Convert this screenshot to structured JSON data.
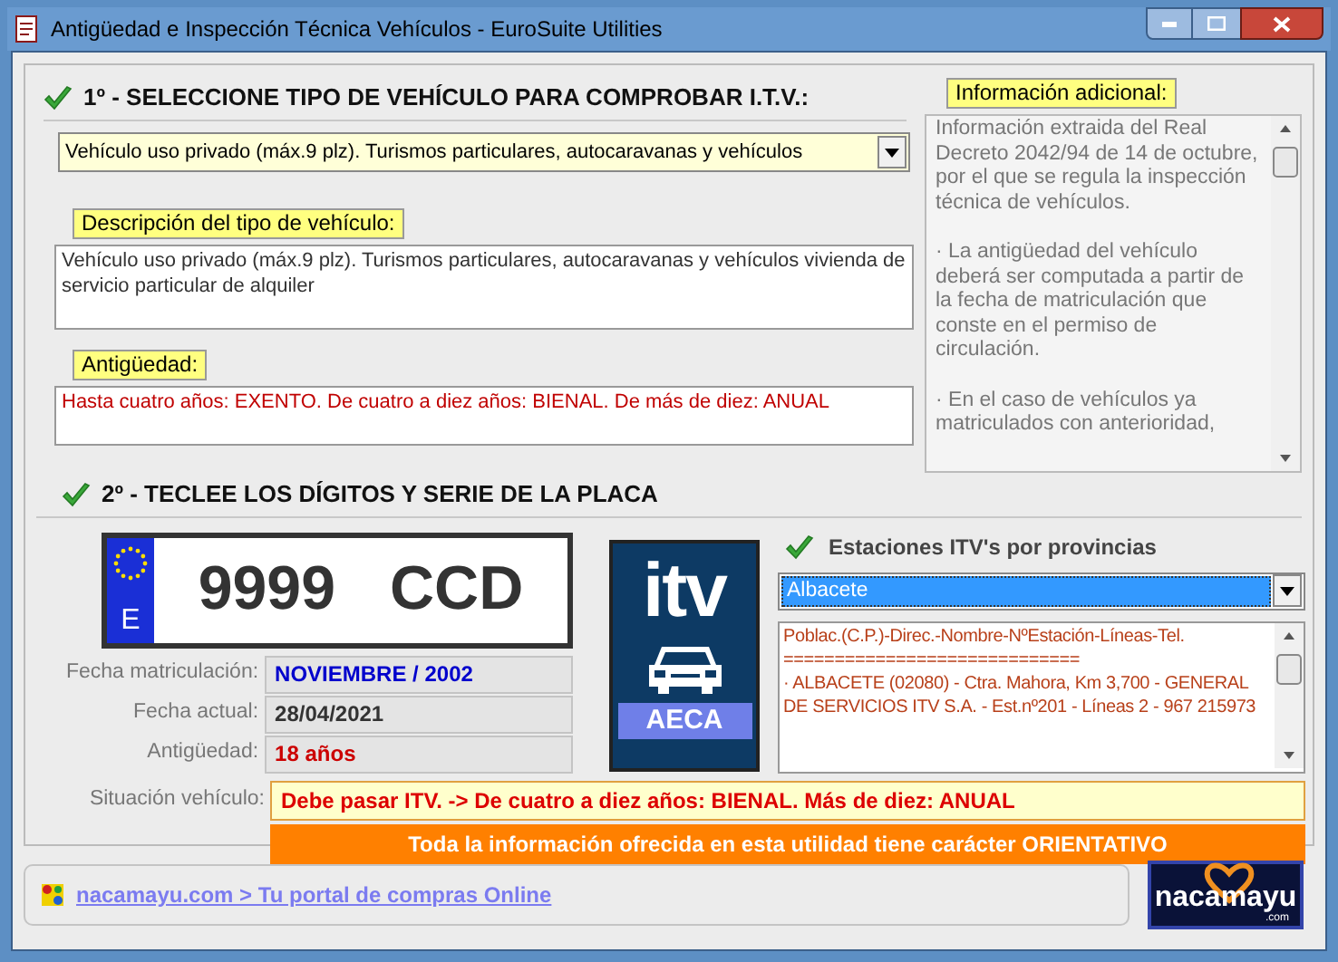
{
  "window": {
    "title": "Antigüedad e Inspección Técnica Vehículos - EuroSuite Utilities"
  },
  "step1": {
    "heading": "1º - SELECCIONE TIPO DE VEHÍCULO PARA COMPROBAR I.T.V.:",
    "vehicle_type_select": {
      "value": "Vehículo uso privado (máx.9 plz). Turismos particulares, autocaravanas y vehículos"
    },
    "description": {
      "label": "Descripción del tipo de vehículo:",
      "text": "Vehículo uso privado (máx.9 plz). Turismos particulares, autocaravanas y vehículos vivienda de servicio particular de alquiler"
    },
    "age_rules": {
      "label": "Antigüedad:",
      "text": "Hasta cuatro años: EXENTO.  De cuatro a diez años: BIENAL.  De más de diez: ANUAL"
    }
  },
  "additional_info": {
    "label": "Información adicional:",
    "paragraphs": [
      "Información extraida del Real Decreto 2042/94 de 14 de octubre, por el que se regula la inspección técnica de vehículos.",
      "· La antigüedad del vehículo deberá ser computada a partir de la fecha de matriculación que conste en el permiso de circulación.",
      "· En el caso de vehículos ya matriculados con anterioridad,"
    ]
  },
  "step2": {
    "heading": "2º - TECLEE LOS DÍGITOS Y SERIE DE LA PLACA",
    "plate": {
      "country": "E",
      "digits": "9999",
      "series": "CCD"
    },
    "fields": [
      {
        "label": "Fecha matriculación:",
        "value": "NOVIEMBRE / 2002",
        "color": "#0000cc"
      },
      {
        "label": "Fecha actual:",
        "value": "28/04/2021",
        "color": "#333333"
      },
      {
        "label": "Antigüedad:",
        "value": "18 años",
        "color": "#cc0000"
      }
    ],
    "itv_logo": {
      "text": "itv",
      "caption": "AECA"
    },
    "stations": {
      "heading": "Estaciones ITV's por provincias",
      "province_select": {
        "value": "Albacete"
      },
      "lines": [
        "Poblac.(C.P.)-Direc.-Nombre-NºEstación-Líneas-Tel.",
        "=============================",
        "· ALBACETE (02080) - Ctra. Mahora, Km 3,700 - GENERAL DE SERVICIOS ITV S.A. - Est.nº201 - Líneas 2 - 967 215973"
      ]
    },
    "situation": {
      "label": "Situación vehículo:",
      "value": "Debe pasar ITV. -> De cuatro a diez años: BIENAL.  Más de diez: ANUAL"
    },
    "notice": "Toda la información ofrecida en esta utilidad tiene carácter ORIENTATIVO"
  },
  "footer": {
    "link": "nacamayu.com > Tu portal de compras Online",
    "logo": {
      "text": "nacamayu",
      "suffix": ".com"
    }
  }
}
